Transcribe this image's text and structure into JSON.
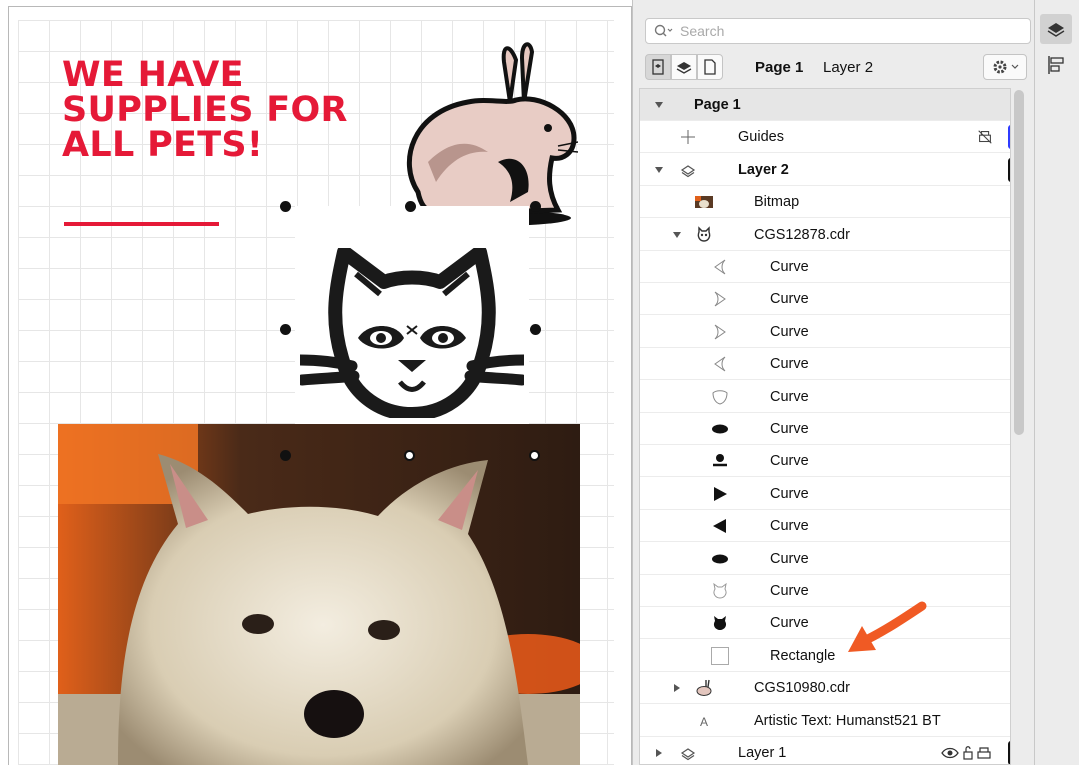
{
  "canvas": {
    "headline_lines": [
      "WE HAVE",
      "SUPPLIES FOR",
      "ALL PETS!"
    ],
    "headline_color": "#e51937"
  },
  "docker": {
    "search_placeholder": "Search",
    "toolbar": {
      "page_label": "Page 1",
      "layer_label": "Layer 2"
    },
    "tree": [
      {
        "label": "Page 1",
        "icon": "none",
        "bold": true,
        "expander": "down",
        "indent": 0
      },
      {
        "label": "Guides",
        "icon": "guides-icon",
        "bold": false,
        "expander": "none",
        "indent": 1,
        "status": "blue-bar"
      },
      {
        "label": "Layer 2",
        "icon": "layer-icon",
        "bold": true,
        "expander": "down",
        "indent": 1,
        "status": "black-bar"
      },
      {
        "label": "Bitmap",
        "icon": "bitmap-thumbnail",
        "bold": false,
        "expander": "none",
        "indent": 2
      },
      {
        "label": "CGS12878.cdr",
        "icon": "cat-group-thumbnail",
        "bold": false,
        "expander": "down",
        "indent": 2
      },
      {
        "label": "Curve",
        "icon": "curve-left-ear-outline",
        "bold": false,
        "expander": "none",
        "indent": 3
      },
      {
        "label": "Curve",
        "icon": "curve-right-ear-outline",
        "bold": false,
        "expander": "none",
        "indent": 3
      },
      {
        "label": "Curve",
        "icon": "curve-right-ear-outline",
        "bold": false,
        "expander": "none",
        "indent": 3
      },
      {
        "label": "Curve",
        "icon": "curve-left-ear-outline",
        "bold": false,
        "expander": "none",
        "indent": 3
      },
      {
        "label": "Curve",
        "icon": "curve-shield-outline",
        "bold": false,
        "expander": "none",
        "indent": 3
      },
      {
        "label": "Curve",
        "icon": "curve-ellipse-filled",
        "bold": false,
        "expander": "none",
        "indent": 3
      },
      {
        "label": "Curve",
        "icon": "curve-nose-filled",
        "bold": false,
        "expander": "none",
        "indent": 3
      },
      {
        "label": "Curve",
        "icon": "curve-triangle-right-filled",
        "bold": false,
        "expander": "none",
        "indent": 3
      },
      {
        "label": "Curve",
        "icon": "curve-triangle-left-filled",
        "bold": false,
        "expander": "none",
        "indent": 3
      },
      {
        "label": "Curve",
        "icon": "curve-ellipse-filled",
        "bold": false,
        "expander": "none",
        "indent": 3
      },
      {
        "label": "Curve",
        "icon": "curve-cat-outline",
        "bold": false,
        "expander": "none",
        "indent": 3
      },
      {
        "label": "Curve",
        "icon": "curve-cat-filled",
        "bold": false,
        "expander": "none",
        "indent": 3
      },
      {
        "label": "Rectangle",
        "icon": "rectangle-outline",
        "bold": false,
        "expander": "none",
        "indent": 3
      },
      {
        "label": "CGS10980.cdr",
        "icon": "rabbit-group-thumbnail",
        "bold": false,
        "expander": "right",
        "indent": 2
      },
      {
        "label": "Artistic Text: Humanst521 BT",
        "icon": "text-a-icon",
        "bold": false,
        "expander": "none",
        "indent": 2
      },
      {
        "label": "Layer 1",
        "icon": "layer-icon",
        "bold": false,
        "expander": "right",
        "indent": 1,
        "status": "eye-lock-print-bar"
      }
    ],
    "guides_status_color": "#2f3bff",
    "annotation_arrow_color": "#f05a24"
  }
}
